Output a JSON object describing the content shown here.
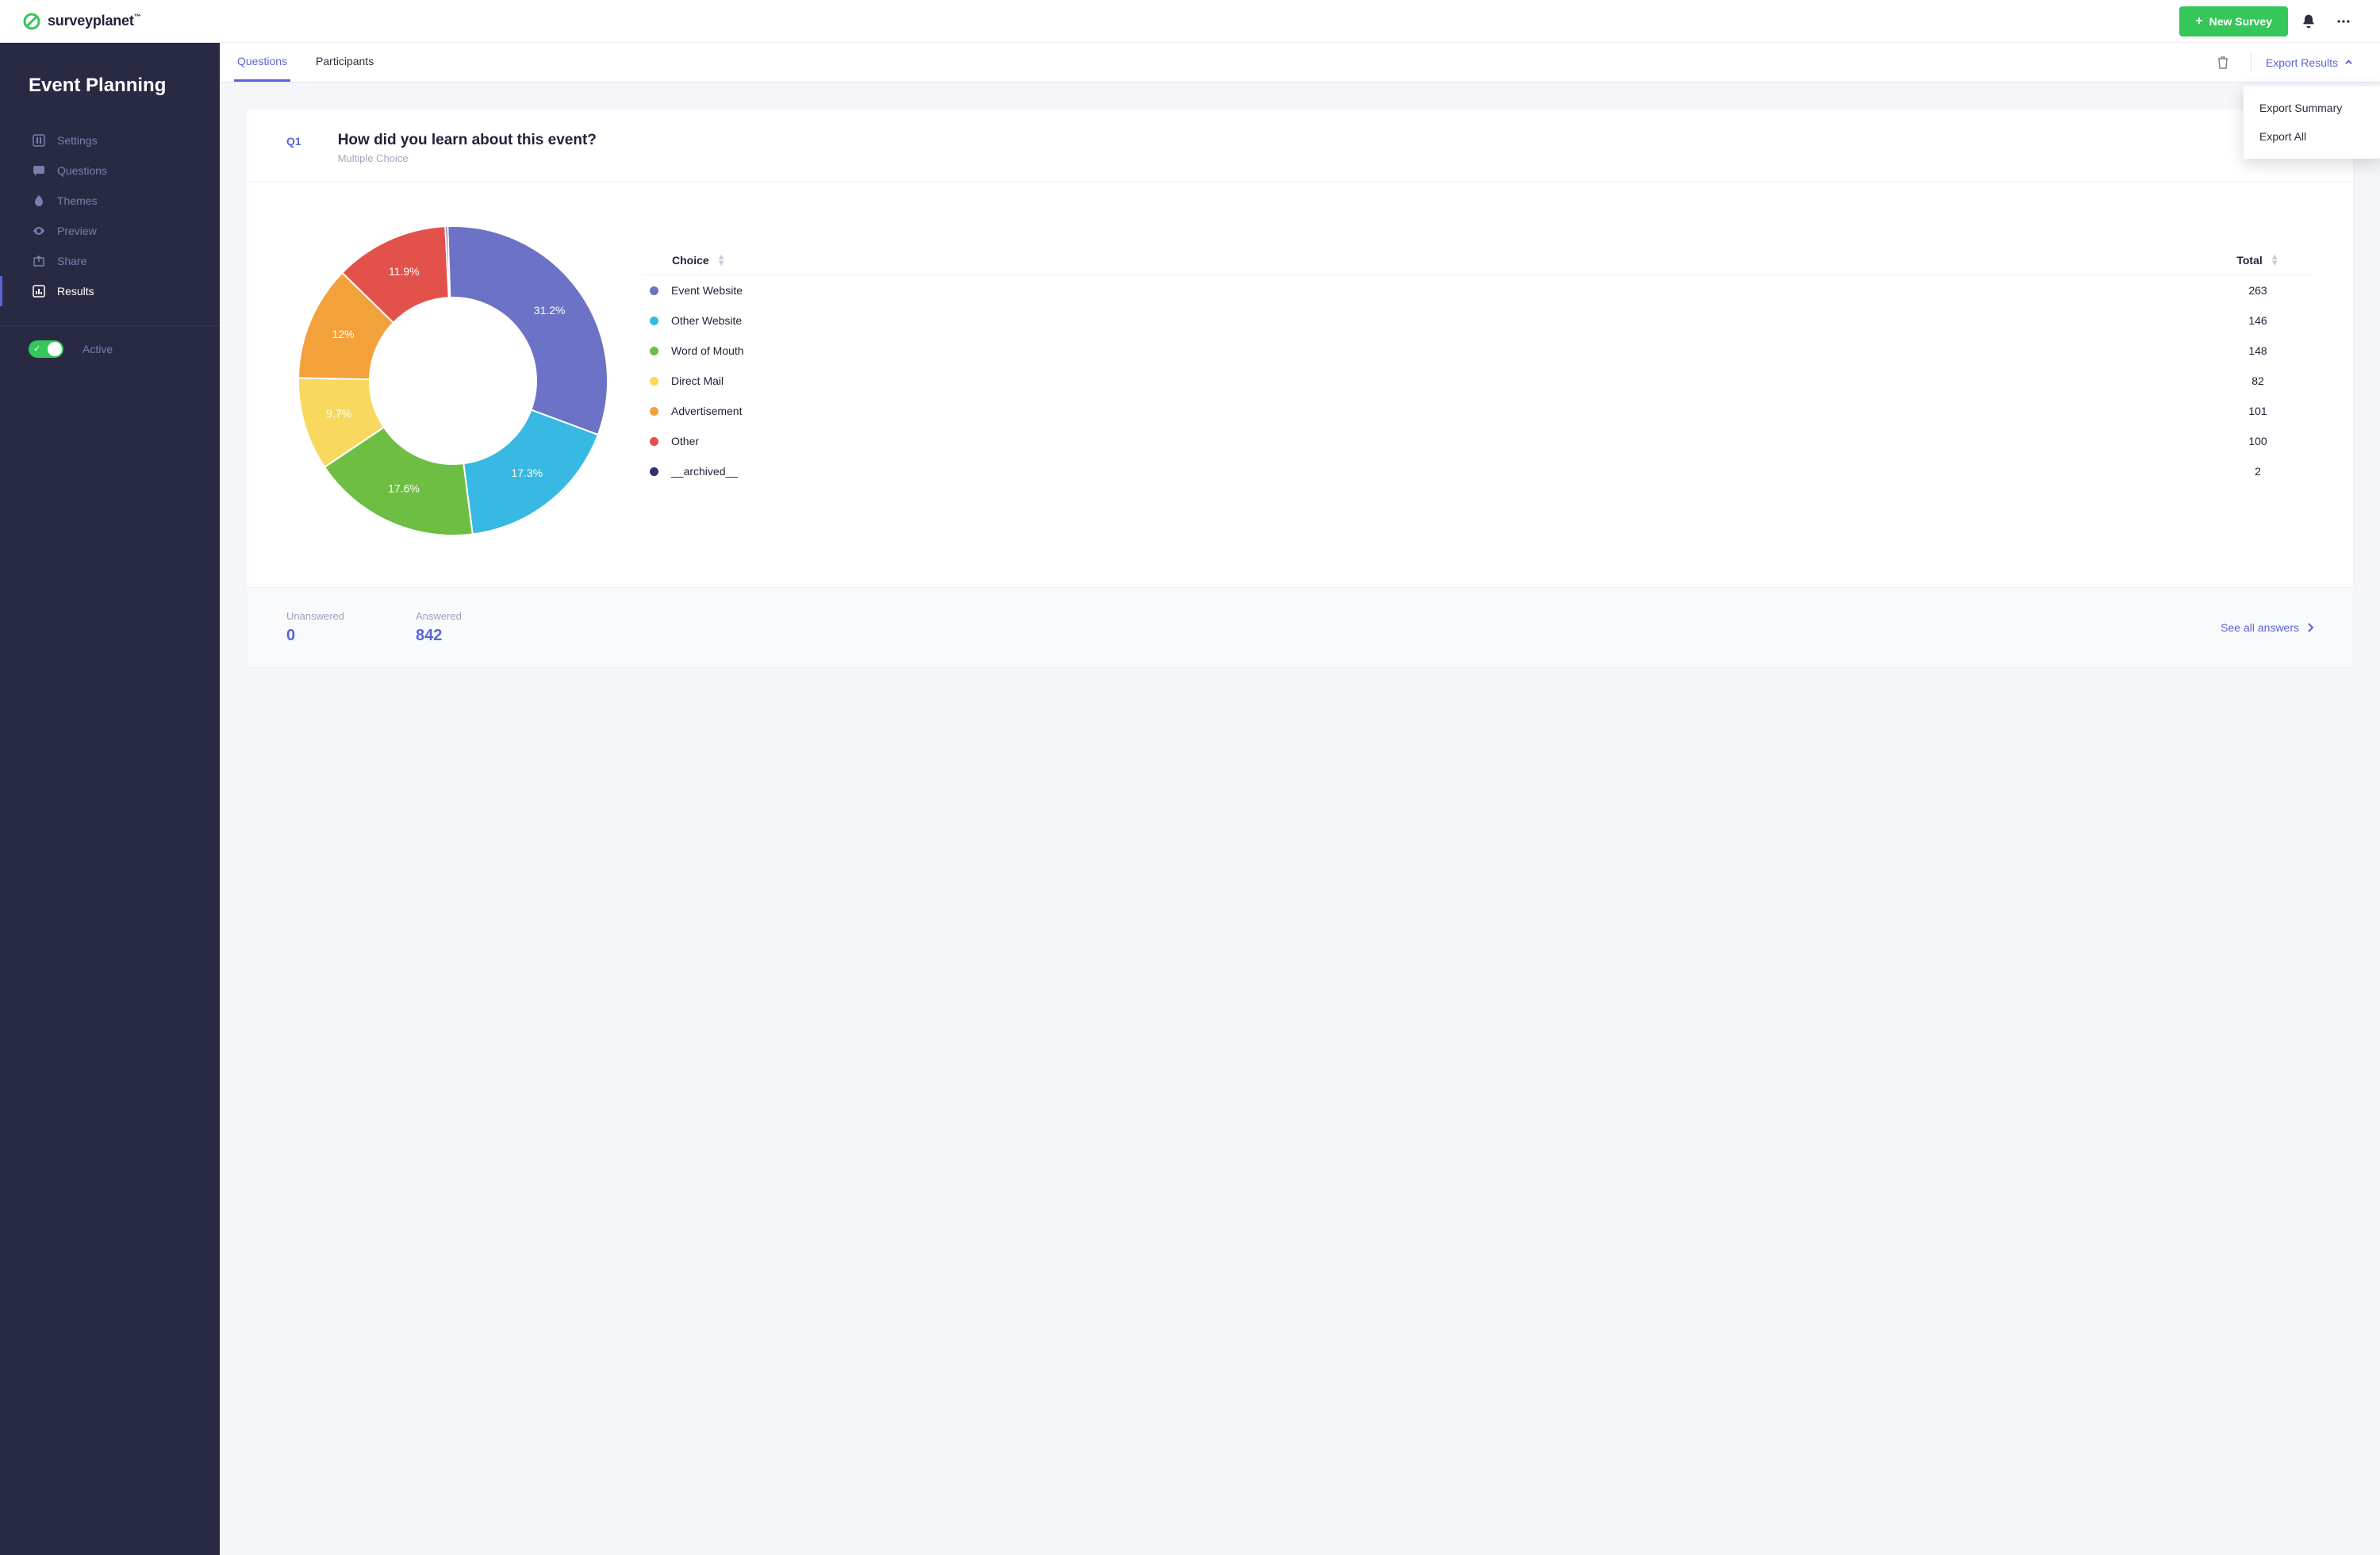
{
  "brand": {
    "name": "surveyplanet"
  },
  "topbar": {
    "new_survey_label": "New Survey"
  },
  "sidebar": {
    "survey_title": "Event Planning",
    "items": [
      {
        "key": "settings",
        "label": "Settings"
      },
      {
        "key": "questions",
        "label": "Questions"
      },
      {
        "key": "themes",
        "label": "Themes"
      },
      {
        "key": "preview",
        "label": "Preview"
      },
      {
        "key": "share",
        "label": "Share"
      },
      {
        "key": "results",
        "label": "Results"
      }
    ],
    "active_toggle_label": "Active"
  },
  "subheader": {
    "tabs": [
      {
        "key": "questions",
        "label": "Questions"
      },
      {
        "key": "participants",
        "label": "Participants"
      }
    ],
    "export_label": "Export Results",
    "export_menu": [
      {
        "key": "summary",
        "label": "Export Summary"
      },
      {
        "key": "all",
        "label": "Export All"
      }
    ]
  },
  "question": {
    "number": "Q1",
    "title": "How did you learn about this event?",
    "type_label": "Multiple Choice",
    "table": {
      "choice_header": "Choice",
      "total_header": "Total"
    },
    "footer": {
      "unanswered_label": "Unanswered",
      "unanswered_value": "0",
      "answered_label": "Answered",
      "answered_value": "842",
      "see_all_label": "See all answers"
    }
  },
  "chart_data": {
    "type": "pie",
    "title": "How did you learn about this event?",
    "series": [
      {
        "name": "Event Website",
        "value": 263,
        "percent": 31.2,
        "percent_label": "31.2%",
        "color": "#6c72c5"
      },
      {
        "name": "Other Website",
        "value": 146,
        "percent": 17.3,
        "percent_label": "17.3%",
        "color": "#37b9e3"
      },
      {
        "name": "Word of Mouth",
        "value": 148,
        "percent": 17.6,
        "percent_label": "17.6%",
        "color": "#6fbe44"
      },
      {
        "name": "Direct Mail",
        "value": 82,
        "percent": 9.7,
        "percent_label": "9.7%",
        "color": "#f8d85e"
      },
      {
        "name": "Advertisement",
        "value": 101,
        "percent": 12.0,
        "percent_label": "12%",
        "color": "#f3a13b"
      },
      {
        "name": "Other",
        "value": 100,
        "percent": 11.9,
        "percent_label": "11.9%",
        "color": "#e3524a"
      },
      {
        "name": "__archived__",
        "value": 2,
        "percent": 0.24,
        "percent_label": "",
        "color": "#2f2e7a"
      }
    ]
  }
}
